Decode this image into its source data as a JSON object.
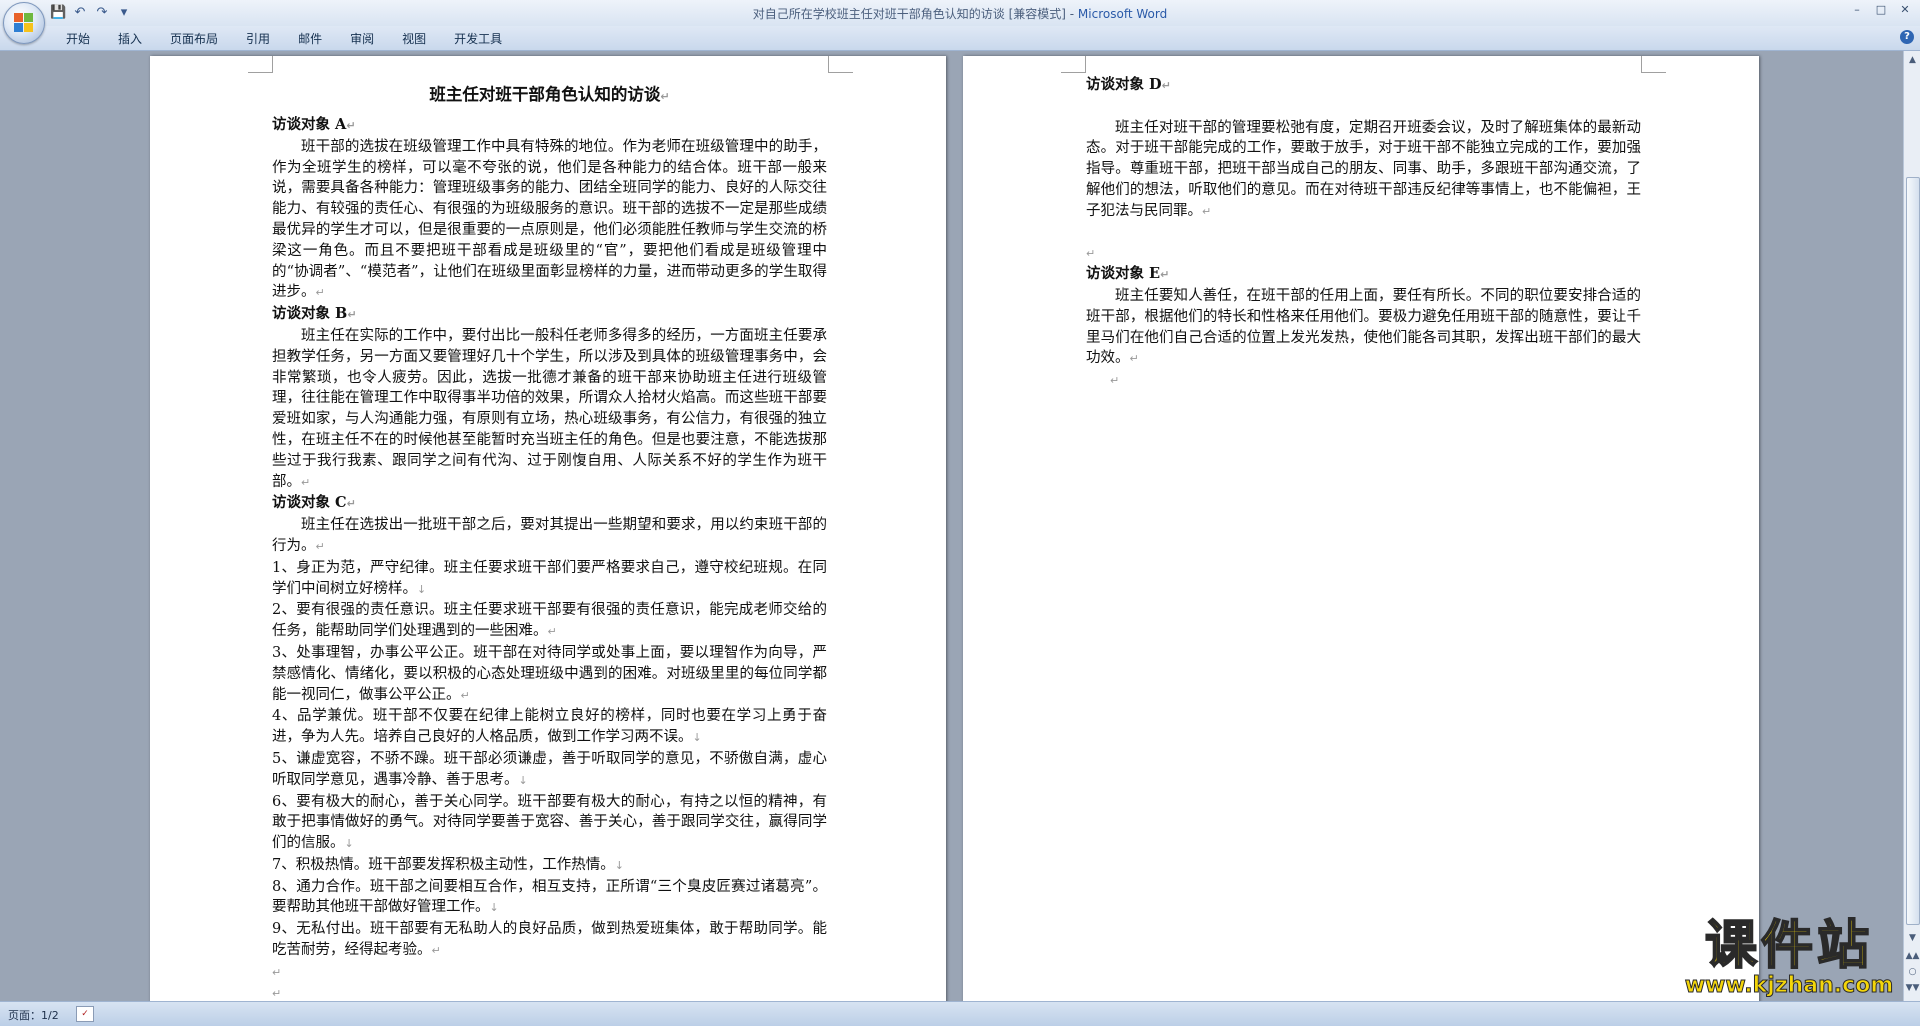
{
  "window": {
    "title_prefix": "对自己所在学校班主任对班干部角色认知的访谈 [兼容模式] - ",
    "title_app": "Microsoft Word",
    "controls": [
      "–",
      "□",
      "✕"
    ]
  },
  "qat": {
    "save": "💾",
    "undo": "↶",
    "redo": "↷",
    "more": "▾"
  },
  "ribbon": {
    "tabs": [
      "开始",
      "插入",
      "页面布局",
      "引用",
      "邮件",
      "审阅",
      "视图",
      "开发工具"
    ],
    "help": "?"
  },
  "page1": {
    "title": "班主任对班干部角色认知的访谈",
    "a_heading": "访谈对象 A",
    "a_text": "班干部的选拔在班级管理工作中具有特殊的地位。作为老师在班级管理中的助手，作为全班学生的榜样，可以毫不夸张的说，他们是各种能力的结合体。班干部一般来说，需要具备各种能力：管理班级事务的能力、团结全班同学的能力、良好的人际交往能力、有较强的责任心、有很强的为班级服务的意识。班干部的选拔不一定是那些成绩最优异的学生才可以，但是很重要的一点原则是，他们必须能胜任教师与学生交流的桥梁这一角色。而且不要把班干部看成是班级里的“官”，要把他们看成是班级管理中的“协调者”、“模范者”，让他们在班级里面彰显榜样的力量，进而带动更多的学生取得进步。",
    "b_heading": "访谈对象 B",
    "b_text": "班主任在实际的工作中，要付出比一般科任老师多得多的经历，一方面班主任要承担教学任务，另一方面又要管理好几十个学生，所以涉及到具体的班级管理事务中，会非常繁琐，也令人疲劳。因此，选拔一批德才兼备的班干部来协助班主任进行班级管理，往往能在管理工作中取得事半功倍的效果，所谓众人拾材火焰高。而这些班干部要爱班如家，与人沟通能力强，有原则有立场，热心班级事务，有公信力，有很强的独立性，在班主任不在的时候他甚至能暂时充当班主任的角色。但是也要注意，不能选拔那些过于我行我素、跟同学之间有代沟、过于刚愎自用、人际关系不好的学生作为班干部。",
    "c_heading": "访谈对象 C",
    "c_intro": "班主任在选拔出一批班干部之后，要对其提出一些期望和要求，用以约束班干部的行为。",
    "c_items": [
      "1、身正为范，严守纪律。班主任要求班干部们要严格要求自己，遵守校纪班规。在同学们中间树立好榜样。",
      "2、要有很强的责任意识。班主任要求班干部要有很强的责任意识，能完成老师交给的任务，能帮助同学们处理遇到的一些困难。",
      "3、处事理智，办事公平公正。班干部在对待同学或处事上面，要以理智作为向导，严禁感情化、情绪化，要以积极的心态处理班级中遇到的困难。对班级里里的每位同学都能一视同仁，做事公平公正。",
      "4、品学兼优。班干部不仅要在纪律上能树立良好的榜样，同时也要在学习上勇于奋进，争为人先。培养自己良好的人格品质，做到工作学习两不误。",
      "5、谦虚宽容，不骄不躁。班干部必须谦虚，善于听取同学的意见，不骄傲自满，虚心听取同学意见，遇事冷静、善于思考。",
      "6、要有极大的耐心，善于关心同学。班干部要有极大的耐心，有持之以恒的精神，有敢于把事情做好的勇气。对待同学要善于宽容、善于关心，善于跟同学交往，赢得同学们的信服。",
      "7、积极热情。班干部要发挥积极主动性，工作热情。",
      "8、通力合作。班干部之间要相互合作，相互支持，正所谓“三个臭皮匠赛过诸葛亮”。要帮助其他班干部做好管理工作。",
      "9、无私付出。班干部要有无私助人的良好品质，做到热爱班集体，敢于帮助同学。能吃苦耐劳，经得起考验。"
    ]
  },
  "page2": {
    "d_heading": "访谈对象 D",
    "d_text": "班主任对班干部的管理要松弛有度，定期召开班委会议，及时了解班集体的最新动态。对于班干部能完成的工作，要敢于放手，对于班干部不能独立完成的工作，要加强指导。尊重班干部，把班干部当成自己的朋友、同事、助手，多跟班干部沟通交流，了解他们的想法，听取他们的意见。而在对待班干部违反纪律等事情上，也不能偏袒，王子犯法与民同罪。",
    "e_heading": "访谈对象 E",
    "e_text": "班主任要知人善任，在班干部的任用上面，要任有所长。不同的职位要安排合适的班干部，根据他们的特长和性格来任用他们。要极力避免任用班干部的随意性，要让千里马们在他们自己合适的位置上发光发热，使他们能各司其职，发挥出班干部们的最大功效。"
  },
  "para_mark": "↵",
  "list_mark": "↓",
  "status": {
    "page_indicator": "页面：1/2",
    "spell_icon": "✓"
  },
  "scrollbar": {
    "up": "▲",
    "down": "▼",
    "prev_page": "▲▲",
    "browse": "○",
    "next_page": "▼▼"
  },
  "watermark": {
    "cn": "课件站",
    "url": "www.kjzhan.com"
  }
}
